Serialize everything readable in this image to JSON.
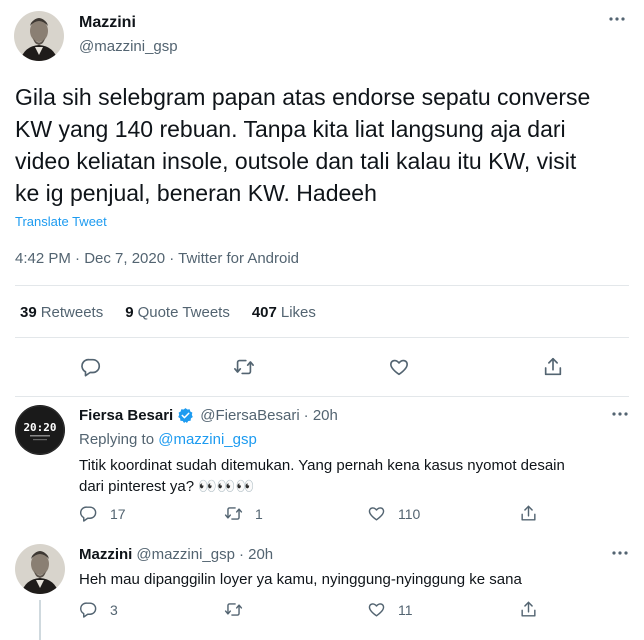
{
  "main_tweet": {
    "author_name": "Mazzini",
    "author_handle": "@mazzini_gsp",
    "text_lines": [
      "Gila sih selebgram papan atas endorse sepatu converse",
      "KW yang 140 rebuan. Tanpa kita liat langsung aja dari",
      "video keliatan insole, outsole dan tali kalau itu KW, visit",
      "ke ig penjual, beneran KW. Hadeeh"
    ],
    "translate_label": "Translate Tweet",
    "meta": "4:42 PM · Dec 7, 2020 · Twitter for Android",
    "stats": {
      "retweets_count": "39",
      "retweets_label": "Retweets",
      "quotes_count": "9",
      "quotes_label": "Quote Tweets",
      "likes_count": "407",
      "likes_label": "Likes"
    }
  },
  "replies": [
    {
      "author_name": "Fiersa Besari",
      "author_handle": "@FiersaBesari",
      "time": "· 20h",
      "verified": true,
      "avatar_text": "20:20",
      "replying_prefix": "Replying to",
      "replying_to": "@mazzini_gsp",
      "text_lines": [
        "Titik koordinat sudah ditemukan. Yang pernah kena kasus nyomot desain",
        "dari pinterest ya? 👀👀👀"
      ],
      "reply_count": "17",
      "retweet_count": "1",
      "like_count": "110"
    },
    {
      "author_name": "Mazzini",
      "author_handle": "@mazzini_gsp",
      "time": "· 20h",
      "verified": false,
      "text_lines": [
        "Heh mau dipanggilin loyer ya kamu, nyinggung-nyinggung ke sana"
      ],
      "reply_count": "3",
      "retweet_count": "",
      "like_count": "11"
    }
  ],
  "colors": {
    "accent": "#1d9bf0",
    "muted_text": "#536471",
    "divider": "#e3e7ea",
    "verified": "#1d9bf0"
  },
  "icons": [
    "more-icon",
    "reply-icon",
    "retweet-icon",
    "like-icon",
    "share-icon",
    "verified-badge-icon"
  ]
}
